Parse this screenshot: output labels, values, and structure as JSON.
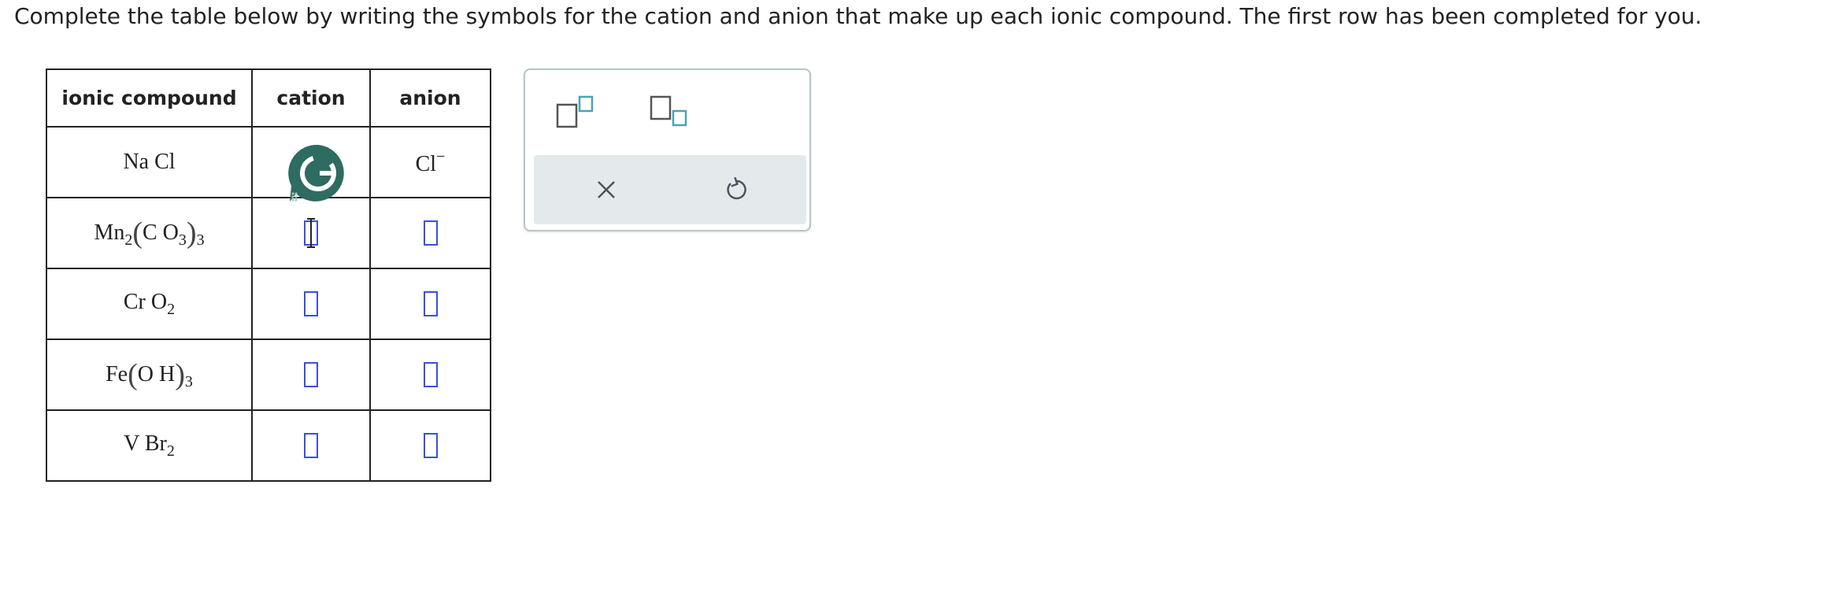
{
  "instructions": "Complete the table below by writing the symbols for the cation and anion that make up each ionic compound. The first row has been completed for you.",
  "table": {
    "headers": [
      "ionic compound",
      "cation",
      "anion"
    ],
    "rows": [
      {
        "compound": {
          "plain": "Na Cl"
        },
        "cation": {
          "badge_letter": "G"
        },
        "anion": {
          "symbol": "Cl",
          "charge": "−"
        }
      },
      {
        "compound": {
          "part1": "Mn",
          "sub1": "2",
          "paren_open": "(",
          "inner": "C O",
          "sub_inner": "3",
          "paren_close": ")",
          "sub_outer": "3"
        }
      },
      {
        "compound": {
          "part1": "Cr O",
          "sub1": "2"
        }
      },
      {
        "compound": {
          "part1": "Fe",
          "paren_open": "(",
          "inner": "O H",
          "paren_close": ")",
          "sub_outer": "3"
        }
      },
      {
        "compound": {
          "part1": "V Br",
          "sub1": "2"
        }
      }
    ]
  },
  "tools": {
    "superscript_icon": "superscript-box-icon",
    "subscript_icon": "subscript-box-icon",
    "clear_icon": "x-icon",
    "undo_icon": "undo-icon"
  },
  "colors": {
    "input_box": "#3b4fe0",
    "teal_icon": "#4aa3b5",
    "badge": "#2e6b60",
    "panel_border": "#b5c6cc",
    "action_bar": "#e4e9ec"
  }
}
